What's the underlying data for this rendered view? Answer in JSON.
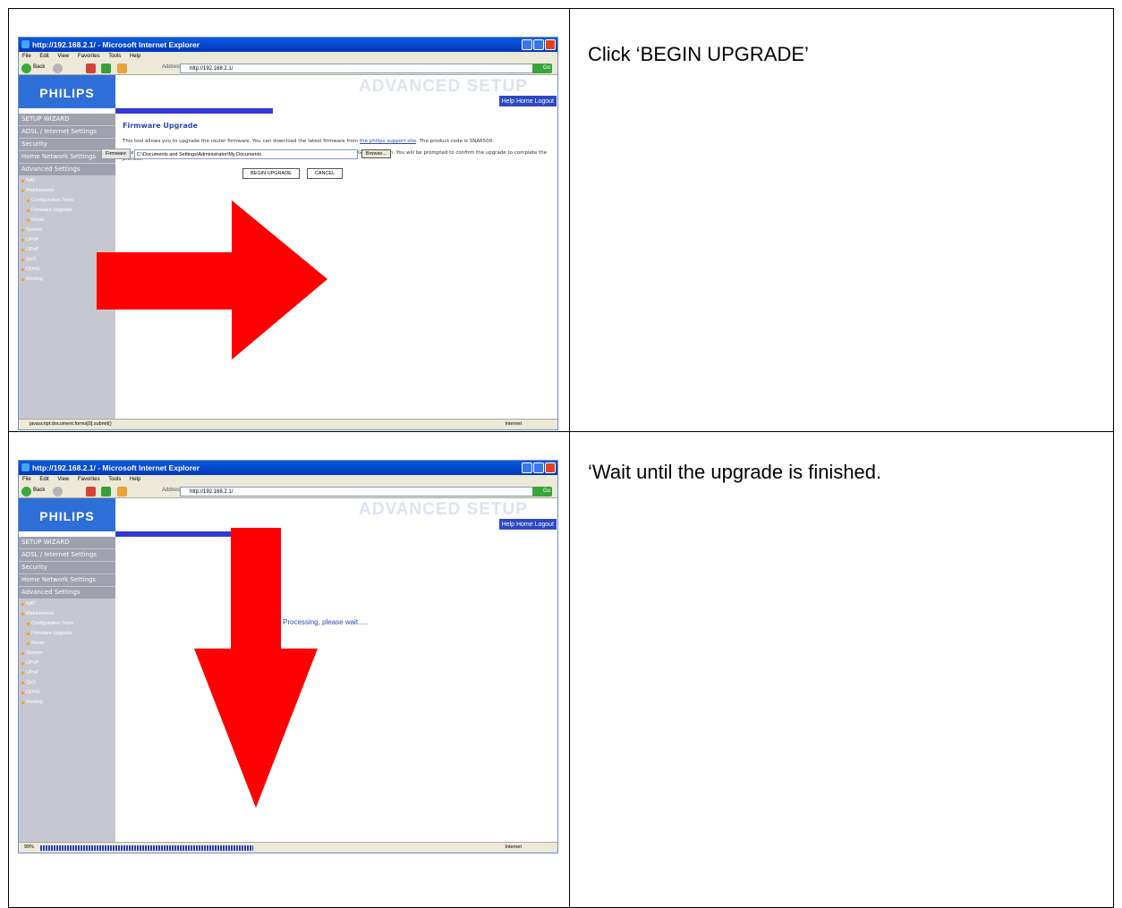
{
  "steps": [
    {
      "instruction": "Click ‘BEGIN UPGRADE’",
      "window_title": "http://192.168.2.1/ - Microsoft Internet Explorer",
      "menu": [
        "File",
        "Edit",
        "View",
        "Favorites",
        "Tools",
        "Help"
      ],
      "back_label": "Back",
      "address_label": "Address",
      "address_value": "http://192.168.2.1/",
      "go_label": "Go",
      "logo": "PHILIPS",
      "banner": "ADVANCED SETUP",
      "help_bar": "Help  Home  Logout",
      "sidebar": {
        "sections": [
          "SETUP WIZARD",
          "ADSL / Internet Settings",
          "Security",
          "Home Network Settings",
          "Advanced Settings"
        ],
        "items": [
          "NAT",
          "Maintanance",
          "Configuration Tools",
          "Firmware Upgrade",
          "Reset",
          "System",
          "UPnP",
          "QoS",
          "DDNS",
          "Routing"
        ]
      },
      "heading": "Firmware Upgrade",
      "para1": "This tool allows you to upgrade the router firmware. You can download the latest firmware from",
      "para1_link": "the philips support site",
      "para1_end": ". The product code is SNA6500.",
      "para2": "Enter the path and name, or browse to the location, of the upgrade file then click the BEGIN UPGRADE button. You will be prompted to confirm the upgrade to complete the process.",
      "firmware_label": "Firmware",
      "file_value": "C:\\Documents and Settings\\Administrator\\My Documents",
      "browse_label": "Browse...",
      "begin_label": "BEGIN UPGRADE",
      "cancel_label": "CANCEL",
      "status_text": "javascript:document.forms[0].submit()",
      "zone_text": "Internet",
      "arrow_color": "#ff0000"
    },
    {
      "instruction": "‘Wait until the upgrade is finished.",
      "window_title": "http://192.168.2.1/ - Microsoft Internet Explorer",
      "menu": [
        "File",
        "Edit",
        "View",
        "Favorites",
        "Tools",
        "Help"
      ],
      "back_label": "Back",
      "address_label": "Address",
      "address_value": "http://192.168.2.1/",
      "go_label": "Go",
      "logo": "PHILIPS",
      "banner": "ADVANCED SETUP",
      "help_bar": "Help  Home  Logout",
      "sidebar": {
        "sections": [
          "SETUP WIZARD",
          "ADSL / Internet Settings",
          "Security",
          "Home Network Settings",
          "Advanced Settings"
        ],
        "items": [
          "NAT",
          "Maintanance",
          "Configuration Tools",
          "Firmware Upgrade",
          "Reset",
          "System",
          "UPnP",
          "QoS",
          "DDNS",
          "Routing"
        ]
      },
      "processing_text": "Processing, please wait.....",
      "status_text": "99%",
      "progress": 0.99,
      "zone_text": "Internet",
      "arrow_color": "#ff0000"
    }
  ]
}
